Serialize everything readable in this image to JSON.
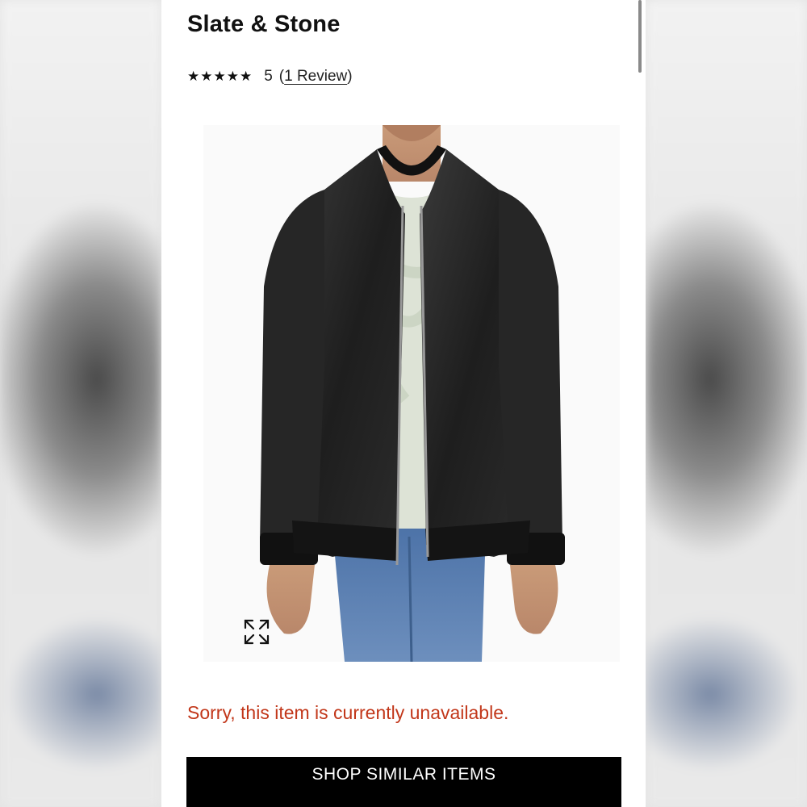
{
  "product": {
    "brand": "Slate & Stone",
    "stars": "★★★★★",
    "rating_score": "5",
    "review_prefix": "(",
    "review_link": "1 Review",
    "review_suffix": ")",
    "image_alt": "Black leather bomber jacket",
    "status_message": "Sorry, this item is currently unavailable.",
    "shop_similar_label": "SHOP SIMILAR ITEMS"
  },
  "icons": {
    "zoom": "expand-icon"
  },
  "colors": {
    "status": "#c2371a",
    "button_bg": "#000000",
    "button_text": "#ffffff"
  }
}
